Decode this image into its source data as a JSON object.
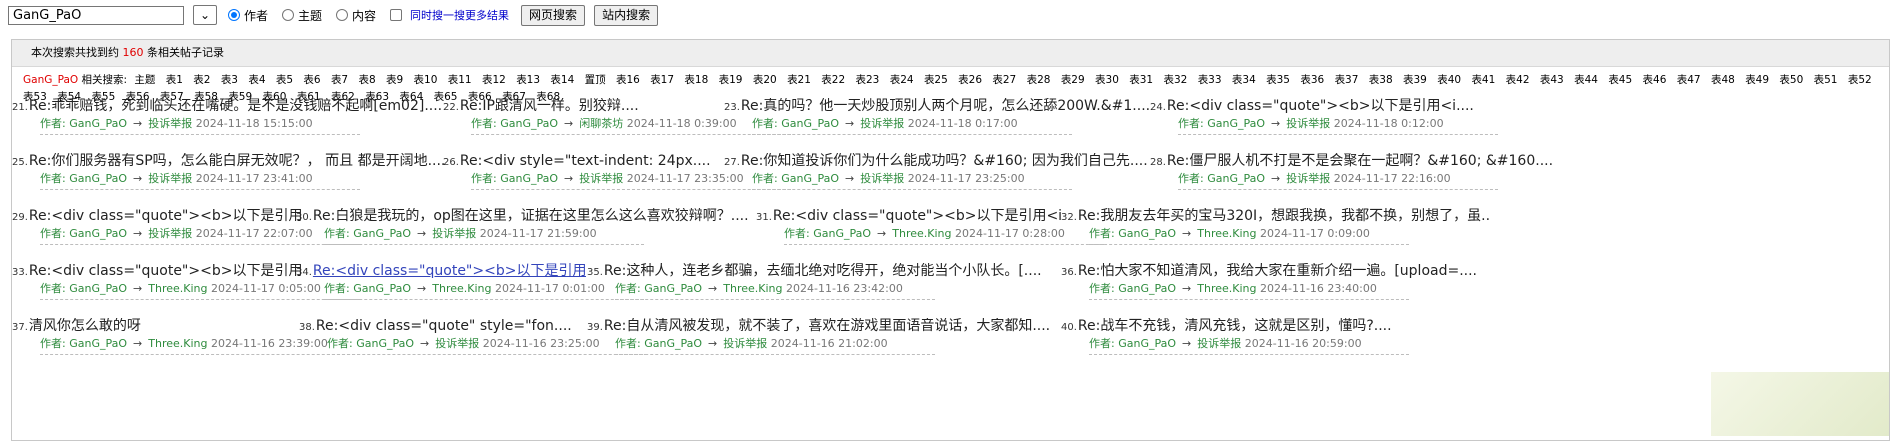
{
  "search": {
    "query": "GanG_PaO",
    "options": [
      "作者",
      "主题",
      "内容"
    ],
    "selected_option": "作者",
    "also_search": "同时搜一搜更多结果",
    "btn_web": "网页搜索",
    "btn_site": "站内搜索"
  },
  "summary": {
    "prefix": "本次搜索共找到约",
    "count": "160",
    "suffix": "条相关帖子记录"
  },
  "tags": {
    "user": "GanG_PaO",
    "label": "相关搜索:",
    "items": [
      "主题",
      "表1",
      "表2",
      "表3",
      "表4",
      "表5",
      "表6",
      "表7",
      "表8",
      "表9",
      "表10",
      "表11",
      "表12",
      "表13",
      "表14",
      "置顶",
      "表16",
      "表17",
      "表18",
      "表19",
      "表20",
      "表21",
      "表22",
      "表23",
      "表24",
      "表25",
      "表26",
      "表27",
      "表28",
      "表29",
      "表30",
      "表31",
      "表32",
      "表33",
      "表34",
      "表35",
      "表36",
      "表37",
      "表38",
      "表39",
      "表40",
      "表41",
      "表42",
      "表43",
      "表44",
      "表45",
      "表46",
      "表47",
      "表48",
      "表49",
      "表50",
      "表51",
      "表52",
      "表53",
      "表54",
      "表55",
      "表56",
      "表57",
      "表58",
      "表59",
      "表60",
      "表61",
      "表62",
      "表63",
      "表64",
      "表65",
      "表66",
      "表67",
      "表68"
    ]
  },
  "arrow": "→",
  "author_prefix": "作者:",
  "results": [
    {
      "n": "21.",
      "title": "Re:乖乖赔钱，死到临头还在嘴硬。是不是没钱赔不起啊[em02]....",
      "author": "GanG_PaO",
      "board": "投诉举报",
      "date": "2024-11-18 15:15:00"
    },
    {
      "n": "22.",
      "title": "Re:IP跟清风一样。别狡辩....",
      "author": "GanG_PaO",
      "board": "闲聊茶坊",
      "date": "2024-11-18 0:39:00"
    },
    {
      "n": "23.",
      "title": "Re:真的吗？他一天炒股顶别人两个月呢，怎么还舔200W.&#1....",
      "author": "GanG_PaO",
      "board": "投诉举报",
      "date": "2024-11-18 0:17:00"
    },
    {
      "n": "24.",
      "title": "Re:<div class=\"quote\"><b>以下是引用<i....",
      "author": "GanG_PaO",
      "board": "投诉举报",
      "date": "2024-11-18 0:12:00"
    },
    {
      "n": "25.",
      "title": "Re:你们服务器有SP吗，怎么能白屏无效呢？， 而且 都是开阔地....",
      "author": "GanG_PaO",
      "board": "投诉举报",
      "date": "2024-11-17 23:41:00"
    },
    {
      "n": "26.",
      "title": "Re:<div style=\"text-indent: 24px....",
      "author": "GanG_PaO",
      "board": "投诉举报",
      "date": "2024-11-17 23:35:00"
    },
    {
      "n": "27.",
      "title": "Re:你知道投诉你们为什么能成功吗？&#160; 因为我们自己先....",
      "author": "GanG_PaO",
      "board": "投诉举报",
      "date": "2024-11-17 23:25:00"
    },
    {
      "n": "28.",
      "title": "Re:僵尸服人机不打是不是会聚在一起啊？&#160; &#160....",
      "author": "GanG_PaO",
      "board": "投诉举报",
      "date": "2024-11-17 22:16:00"
    },
    {
      "n": "29.",
      "title": "Re:<div class=\"quote\"><b>以下是引用<i....",
      "author": "GanG_PaO",
      "board": "投诉举报",
      "date": "2024-11-17 22:07:00"
    },
    {
      "n": "30.",
      "title": "Re:白狼是我玩的，op图在这里，证据在这里怎么这么喜欢狡辩啊？....",
      "author": "GanG_PaO",
      "board": "投诉举报",
      "date": "2024-11-17 21:59:00"
    },
    {
      "n": "31.",
      "title": "Re:<div class=\"quote\"><b>以下是引用<i....",
      "author": "GanG_PaO",
      "board": "Three.King",
      "date": "2024-11-17 0:28:00"
    },
    {
      "n": "32.",
      "title": "Re:我朋友去年买的宝马320I，想跟我换，我都不换，别想了，虽....",
      "author": "GanG_PaO",
      "board": "Three.King",
      "date": "2024-11-17 0:09:00"
    },
    {
      "n": "33.",
      "title": "Re:<div class=\"quote\"><b>以下是引用<i....",
      "author": "GanG_PaO",
      "board": "Three.King",
      "date": "2024-11-17 0:05:00"
    },
    {
      "n": "34.",
      "title": "Re:<div class=\"quote\"><b>以下是引用<i....",
      "author": "GanG_PaO",
      "board": "Three.King",
      "date": "2024-11-17 0:01:00",
      "visited": true
    },
    {
      "n": "35.",
      "title": "Re:这种人，连老乡都骗，去缅北绝对吃得开，绝对能当个小队长。[....",
      "author": "GanG_PaO",
      "board": "Three.King",
      "date": "2024-11-16 23:42:00"
    },
    {
      "n": "36.",
      "title": "Re:怕大家不知道清风，我给大家在重新介绍一遍。[upload=....",
      "author": "GanG_PaO",
      "board": "Three.King",
      "date": "2024-11-16 23:40:00"
    },
    {
      "n": "37.",
      "title": "清风你怎么敢的呀",
      "author": "GanG_PaO",
      "board": "Three.King",
      "date": "2024-11-16 23:39:00"
    },
    {
      "n": "38.",
      "title": "Re:<div class=\"quote\" style=\"fon....",
      "author": "GanG_PaO",
      "board": "投诉举报",
      "date": "2024-11-16 23:25:00"
    },
    {
      "n": "39.",
      "title": "Re:自从清风被发现，就不装了，喜欢在游戏里面语音说话，大家都知....",
      "author": "GanG_PaO",
      "board": "投诉举报",
      "date": "2024-11-16 21:02:00"
    },
    {
      "n": "40.",
      "title": "Re:战车不充钱，清风充钱，这就是区别，懂吗?....",
      "author": "GanG_PaO",
      "board": "投诉举报",
      "date": "2024-11-16 20:59:00"
    }
  ]
}
